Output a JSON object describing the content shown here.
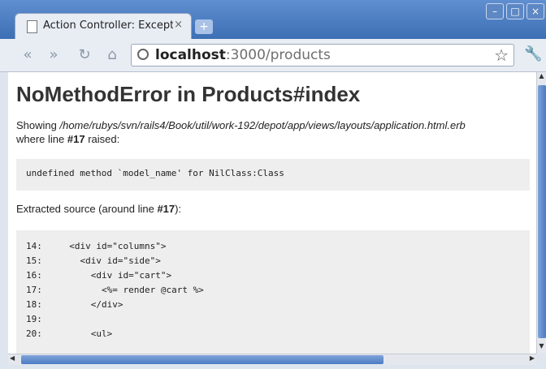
{
  "tab": {
    "title": "Action Controller: Excepti",
    "close": "×",
    "new": "+"
  },
  "window_controls": {
    "minimize": "–",
    "maximize": "□",
    "close": "×"
  },
  "toolbar": {
    "back": "«",
    "forward": "»",
    "reload": "↻",
    "home": "⌂",
    "wrench": "🔧"
  },
  "omnibox": {
    "host": "localhost",
    "rest": ":3000/products",
    "star": "☆"
  },
  "page": {
    "title": "NoMethodError in Products#index",
    "showing_prefix": "Showing ",
    "showing_path": "/home/rubys/svn/rails4/Book/util/work-192/depot/app/views/layouts/application.html.erb",
    "where_prefix": "where line ",
    "line_ref": "#17",
    "where_suffix": " raised:",
    "message": "undefined method `model_name' for NilClass:Class",
    "extracted_prefix": "Extracted source (around line ",
    "extracted_suffix": "):",
    "source": [
      {
        "num": "14:",
        "code": "  <div id=\"columns\">"
      },
      {
        "num": "15:",
        "code": "    <div id=\"side\">"
      },
      {
        "num": "16:",
        "code": "      <div id=\"cart\">"
      },
      {
        "num": "17:",
        "code": "        <%= render @cart %>"
      },
      {
        "num": "18:",
        "code": "      </div>"
      },
      {
        "num": "19:",
        "code": ""
      },
      {
        "num": "20:",
        "code": "      <ul>"
      }
    ]
  }
}
